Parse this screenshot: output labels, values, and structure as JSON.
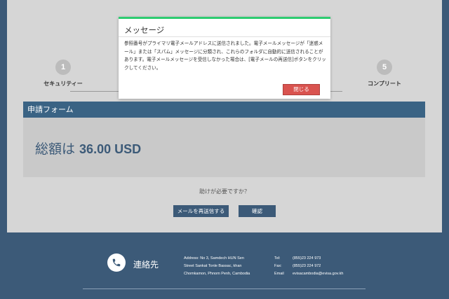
{
  "steps": [
    {
      "number": "1",
      "label": "セキュリティー"
    },
    {
      "number": "5",
      "label": "コンプリート"
    }
  ],
  "form": {
    "header": "申請フォーム",
    "total_label": "総額は ",
    "total_amount": "36.00 USD"
  },
  "help_text": "助けが必要ですか？",
  "buttons": {
    "resend": "メールを再送信する",
    "confirm": "確認"
  },
  "footer": {
    "contact_title": "連絡先",
    "address_lines": [
      "Address: No 3, Samdech HUN Sen",
      "Street Sankat Tonle Bassac, khan",
      "Chomkamon, Phnom Penh, Cambodia"
    ],
    "info_keys": [
      "Tel:",
      "Fax:",
      "Email"
    ],
    "info_values": [
      "(855)23 224 973",
      "(855)23 224 972",
      "evisacambodia@evisa.gov.kh"
    ]
  },
  "modal": {
    "title": "メッセージ",
    "body": "参照番号がプライマリ電子メールアドレスに送信されました。電子メールメッセージが「迷惑メール」または「スパム」メッセージに分類され、これらのフォルダに自動的に送信されることがあります。電子メールメッセージを受信しなかった場合は、[電子メールの再送信]ボタンをクリックしてください。",
    "close_label": "閉じる"
  },
  "colors": {
    "brand": "#3c5a78",
    "modal_accent": "#2ecc71",
    "close_button": "#d9534f"
  }
}
